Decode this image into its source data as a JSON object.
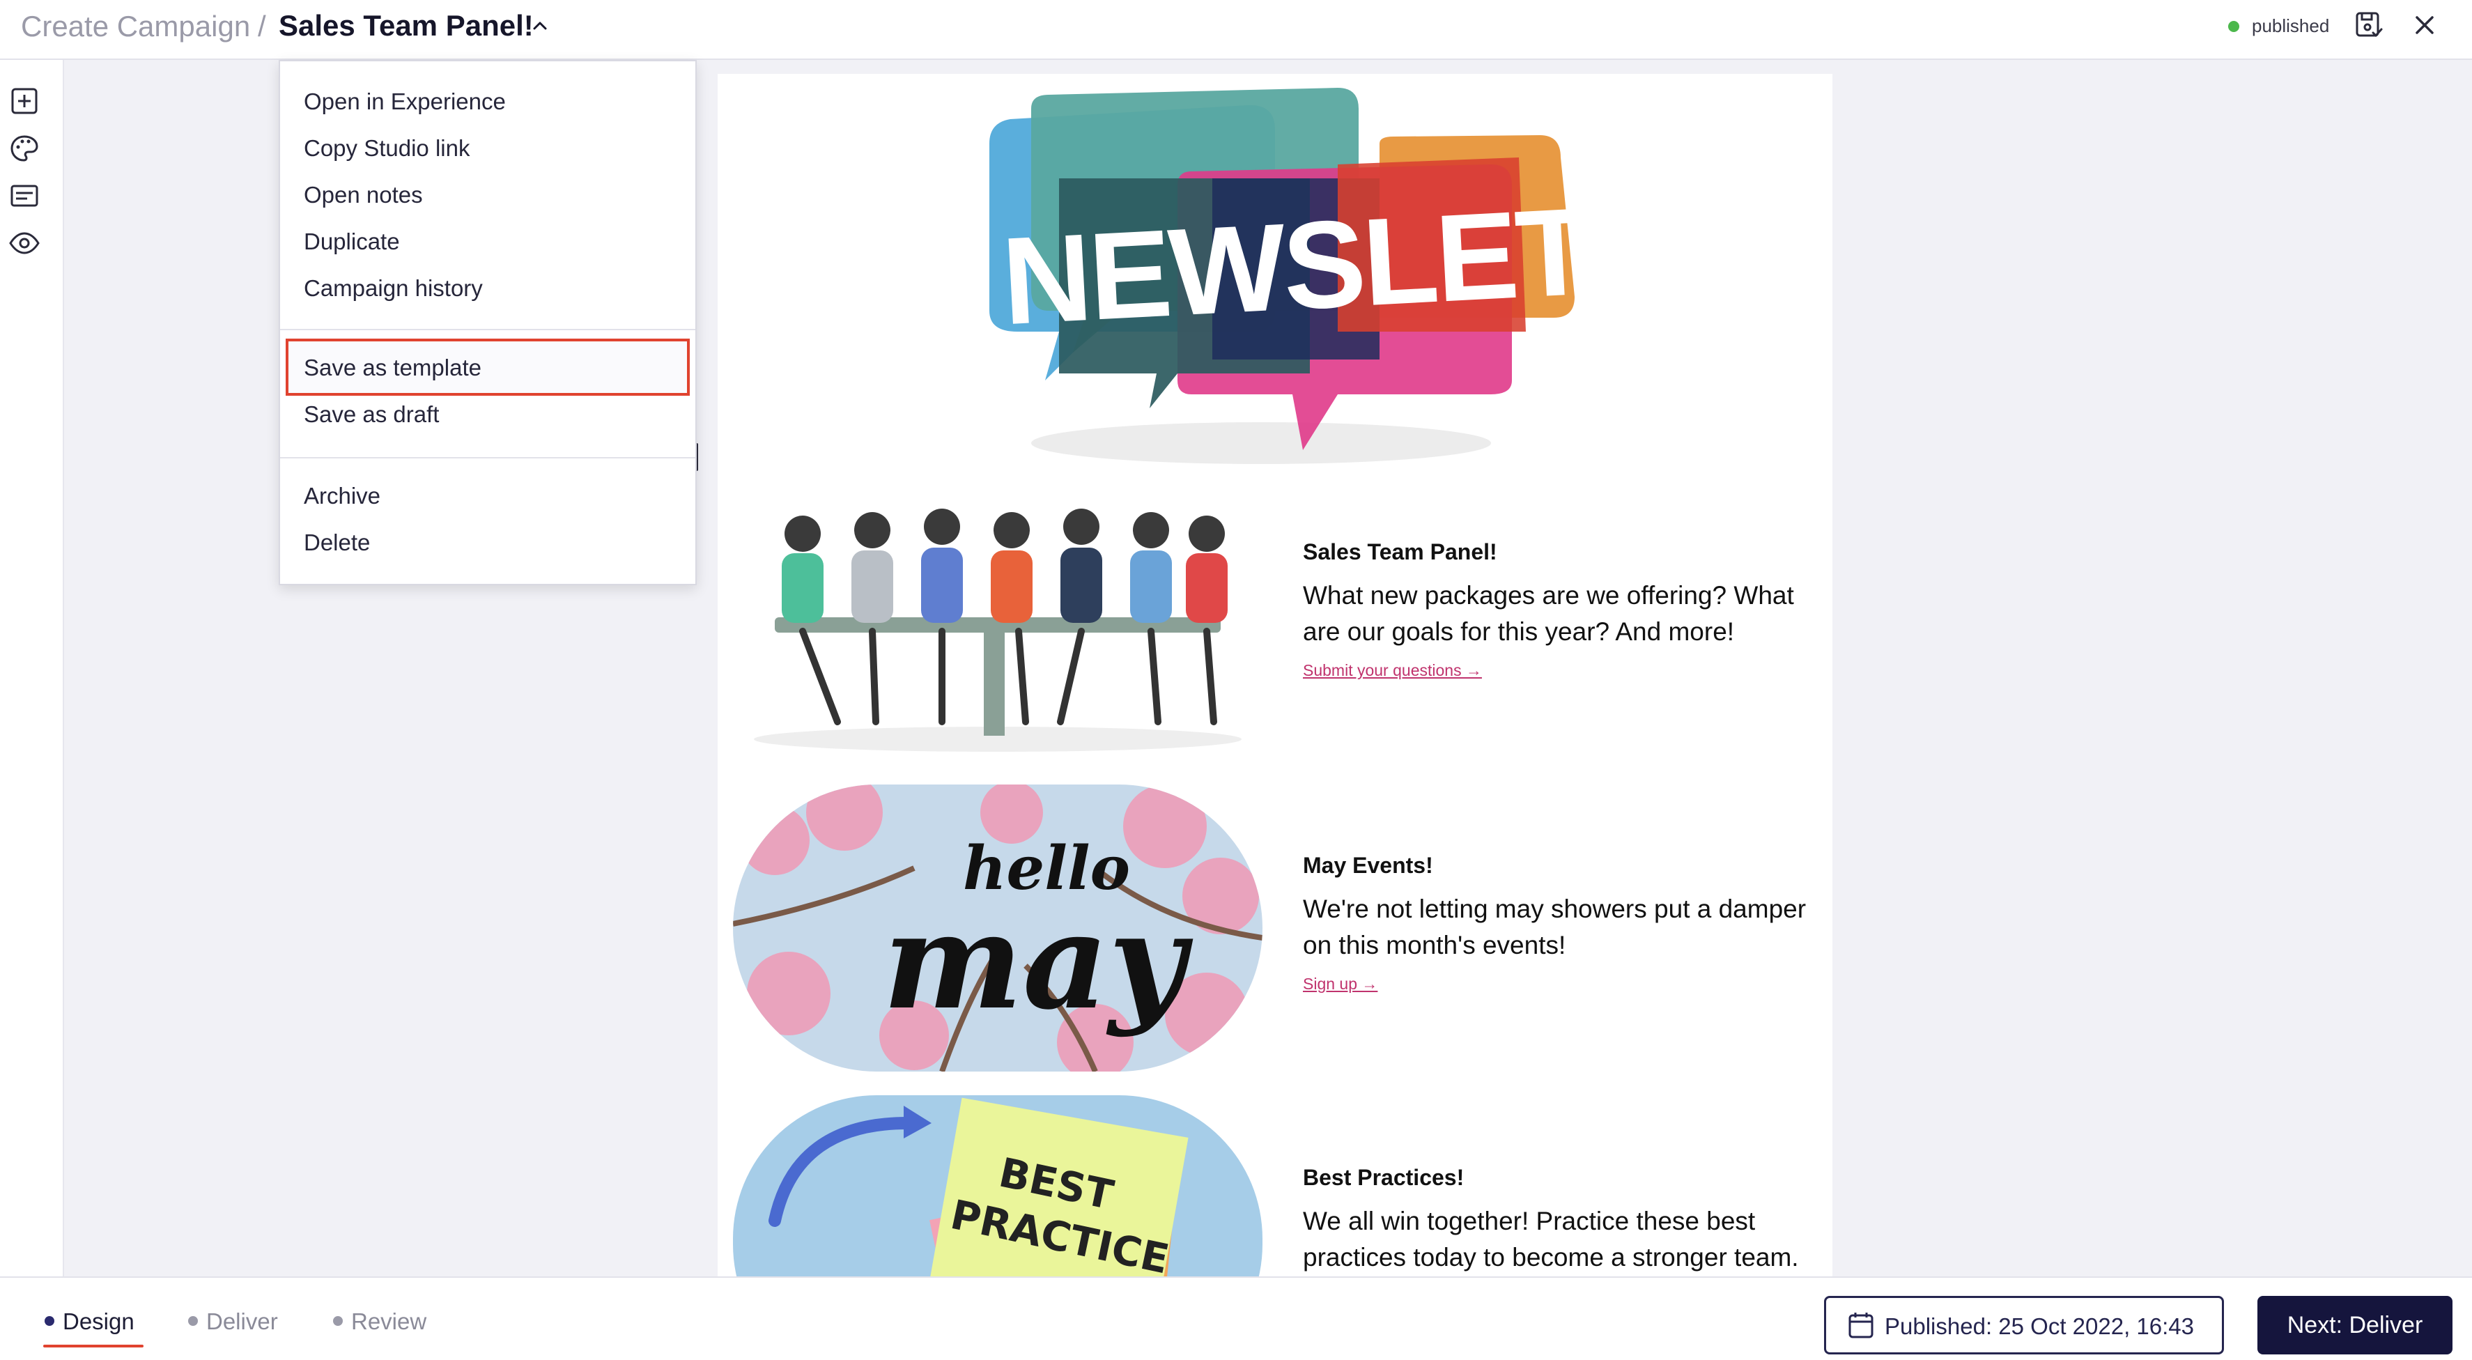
{
  "header": {
    "breadcrumb_root": "Create Campaign",
    "breadcrumb_separator": "/",
    "campaign_title": "Sales Team Panel!",
    "status_label": "published",
    "status_color": "#4cb84c",
    "icons": [
      "chevron-up-icon",
      "save-check-icon",
      "close-icon"
    ]
  },
  "sidebar": {
    "tools": [
      {
        "name": "add-block-icon"
      },
      {
        "name": "palette-icon"
      },
      {
        "name": "text-block-icon"
      },
      {
        "name": "preview-eye-icon"
      }
    ]
  },
  "menu": {
    "group1": [
      "Open in Experience",
      "Copy Studio link",
      "Open notes",
      "Duplicate",
      "Campaign history"
    ],
    "group2": [
      "Save as template",
      "Save as draft"
    ],
    "group3": [
      "Archive",
      "Delete"
    ],
    "highlighted_item": "Save as template",
    "highlight_color": "#e0432f"
  },
  "email": {
    "hero_text": "NEWSLETTER",
    "sections": [
      {
        "title": "Sales Team Panel!",
        "body": "What new packages are we offering? What are our goals for this year? And more!",
        "link": "Submit your questions →"
      },
      {
        "title": "May Events!",
        "body": "We're not letting may showers put a damper on this month's events!",
        "link": "Sign up →",
        "image_text_1": "hello",
        "image_text_2": "may"
      },
      {
        "title": "Best Practices!",
        "body": "We all win together! Practice these best practices today to become a stronger team.",
        "image_text_1": "BEST",
        "image_text_2": "PRACTICE"
      }
    ],
    "link_color": "#c0336d"
  },
  "footer": {
    "steps": [
      {
        "label": "Design",
        "active": true
      },
      {
        "label": "Deliver",
        "active": false
      },
      {
        "label": "Review",
        "active": false
      }
    ],
    "published_label": "Published: 25 Oct 2022, 16:43",
    "next_label": "Next: Deliver",
    "accent_color": "#15153d"
  }
}
